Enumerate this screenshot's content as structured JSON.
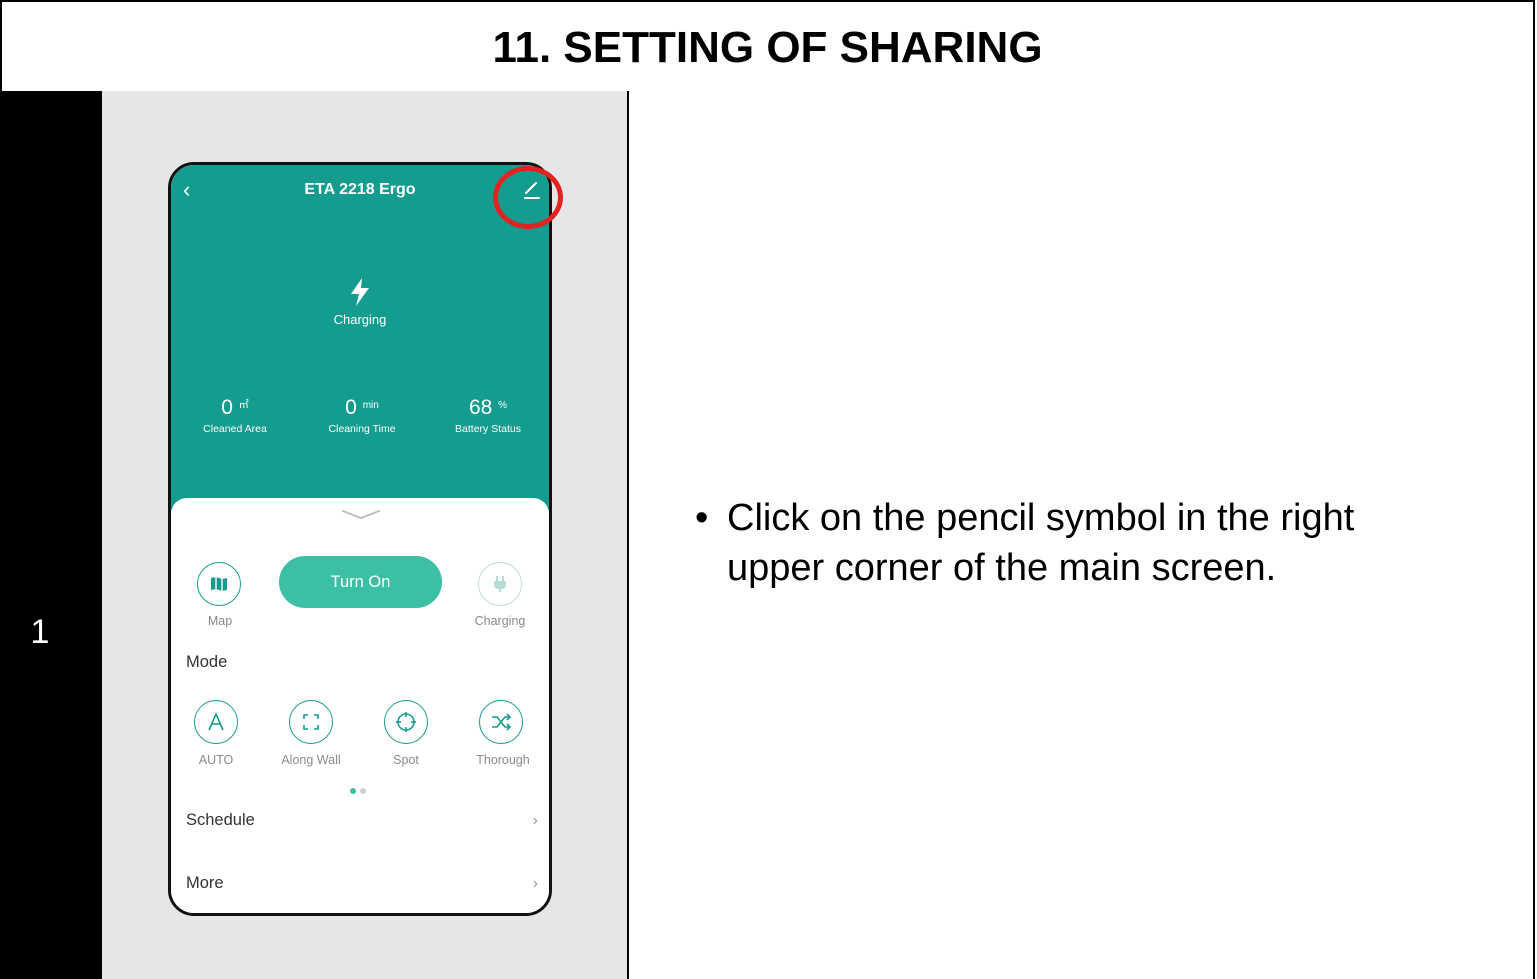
{
  "header": {
    "title": "11. SETTING OF SHARING"
  },
  "step": {
    "number": "1"
  },
  "instruction": {
    "bullet": "•",
    "text": "Click on the pencil symbol in the right upper corner of the main screen."
  },
  "phone": {
    "title": "ETA 2218 Ergo",
    "status": "Charging",
    "stats": [
      {
        "value": "0",
        "unit": "㎡",
        "label": "Cleaned Area"
      },
      {
        "value": "0",
        "unit": "min",
        "label": "Cleaning Time"
      },
      {
        "value": "68",
        "unit": "%",
        "label": "Battery Status"
      }
    ],
    "controls": {
      "map_label": "Map",
      "turn_on_label": "Turn On",
      "charging_label": "Charging"
    },
    "mode_title": "Mode",
    "modes": [
      {
        "label": "AUTO",
        "icon": "auto-icon"
      },
      {
        "label": "Along Wall",
        "icon": "along-wall-icon"
      },
      {
        "label": "Spot",
        "icon": "spot-icon"
      },
      {
        "label": "Thorough",
        "icon": "thorough-icon"
      }
    ],
    "rows": [
      {
        "label": "Schedule"
      },
      {
        "label": "More"
      }
    ],
    "pager": {
      "pages": 2,
      "active": 1
    }
  },
  "colors": {
    "teal": "#149c8f",
    "button": "#3bbfa5",
    "highlight": "#e32222"
  }
}
